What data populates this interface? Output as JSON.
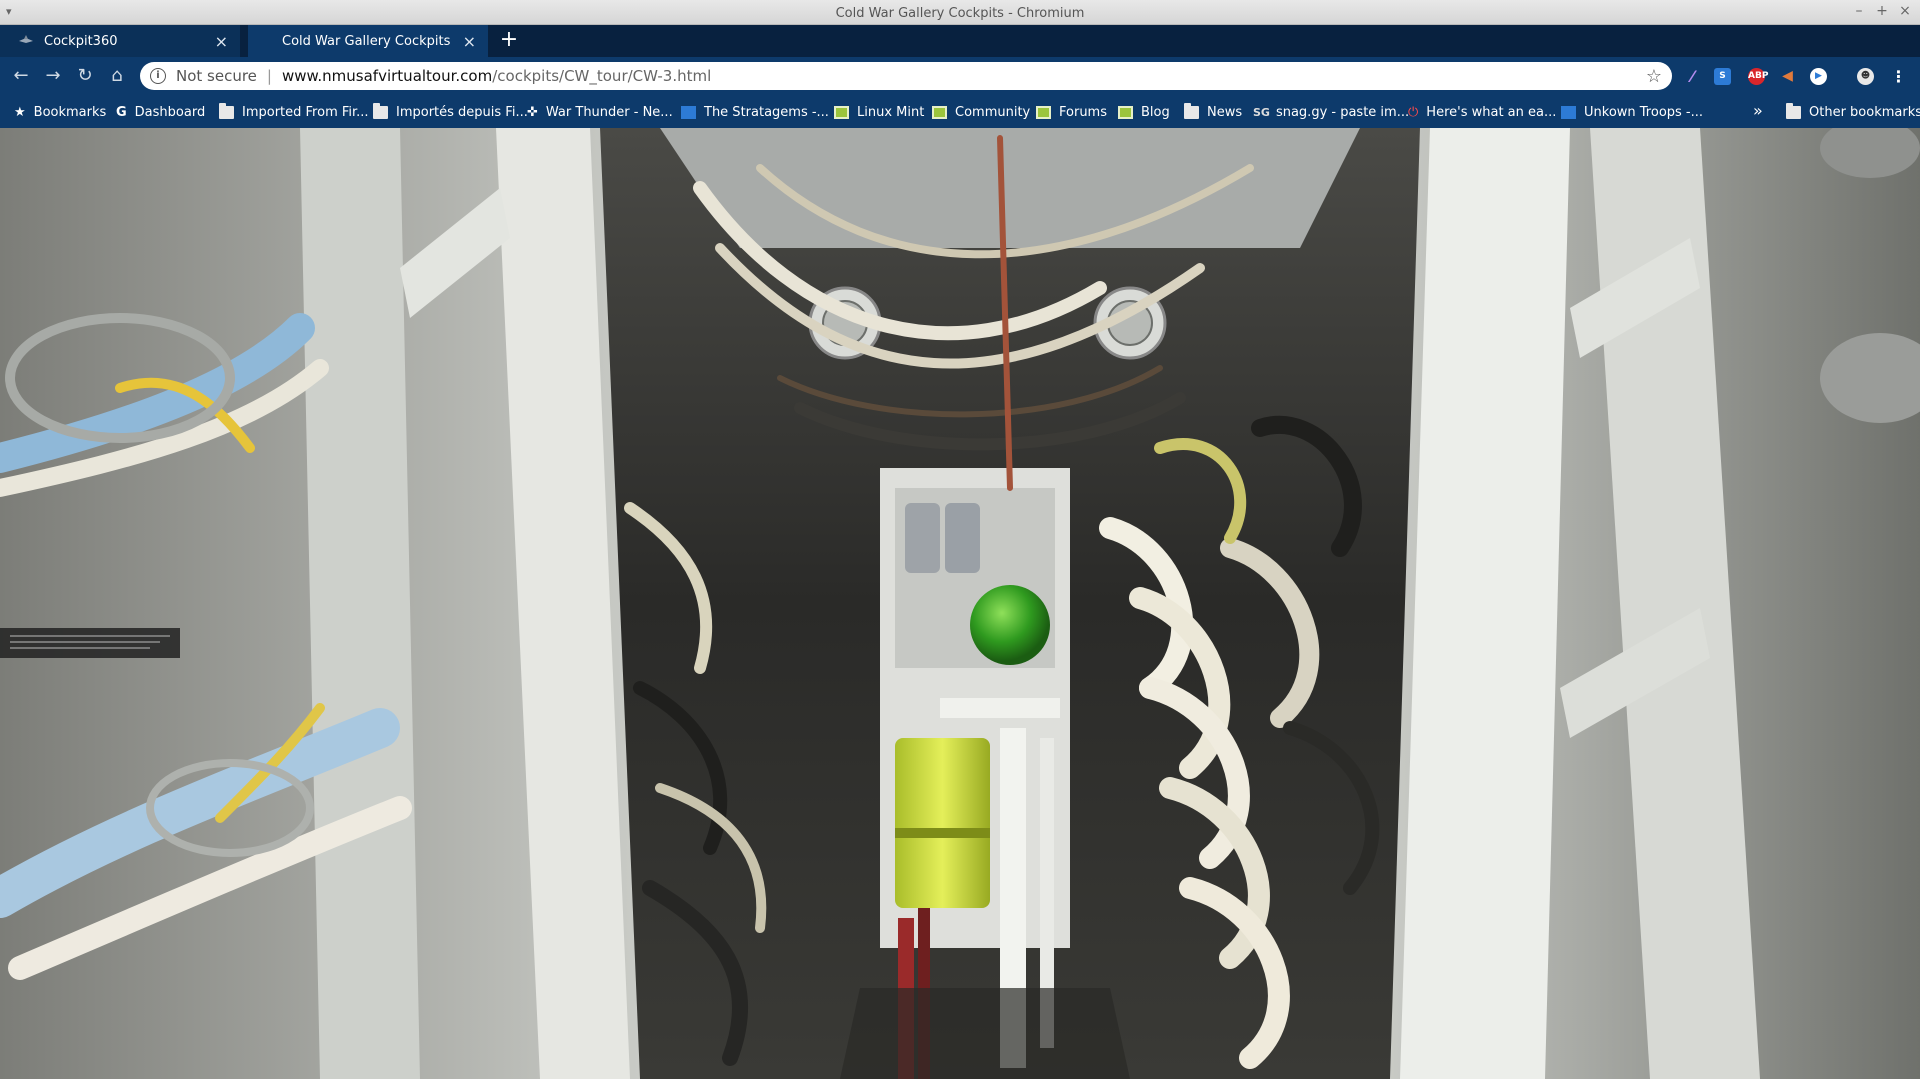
{
  "window": {
    "title": "Cold War Gallery Cockpits - Chromium"
  },
  "tabs": [
    {
      "label": "Cockpit360",
      "active": false
    },
    {
      "label": "Cold War Gallery Cockpits",
      "active": true
    }
  ],
  "toolbar": {
    "security_label": "Not secure",
    "url_host": "www.nmusafvirtualtour.com",
    "url_path": "/cockpits/CW_tour/CW-3.html"
  },
  "bookmarks": {
    "items": [
      {
        "label": "Bookmarks",
        "icon": "star-icon"
      },
      {
        "label": "Dashboard",
        "icon": "google-icon"
      },
      {
        "label": "Imported From Fir...",
        "icon": "folder-icon"
      },
      {
        "label": "Importés depuis Fi...",
        "icon": "folder-icon"
      },
      {
        "label": "War Thunder - Ne...",
        "icon": "war-thunder-icon"
      },
      {
        "label": "The Stratagems -...",
        "icon": "trello-icon"
      },
      {
        "label": "Linux Mint",
        "icon": "linux-mint-icon"
      },
      {
        "label": "Community",
        "icon": "linux-mint-icon"
      },
      {
        "label": "Forums",
        "icon": "linux-mint-icon"
      },
      {
        "label": "Blog",
        "icon": "linux-mint-icon"
      },
      {
        "label": "News",
        "icon": "folder-icon"
      },
      {
        "label": "snag.gy - paste im...",
        "icon": "snaggy-icon"
      },
      {
        "label": "Here's what an ea...",
        "icon": "power-icon"
      },
      {
        "label": "Unkown Troops -...",
        "icon": "trello-icon"
      }
    ],
    "other_label": "Other bookmarks"
  },
  "colors": {
    "tabstrip": "#08213f",
    "toolbar": "#0d3a6b",
    "accent_green": "#9bc53d"
  }
}
